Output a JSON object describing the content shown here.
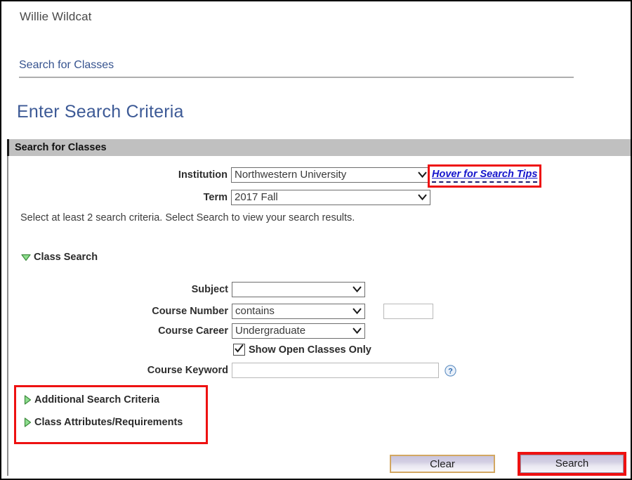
{
  "header": {
    "user_name": "Willie Wildcat",
    "breadcrumb_link": "Search for Classes",
    "page_title": "Enter Search Criteria"
  },
  "group": {
    "header_label": "Search for Classes"
  },
  "form": {
    "institution": {
      "label": "Institution",
      "value": "Northwestern University"
    },
    "term": {
      "label": "Term",
      "value": "2017 Fall"
    },
    "search_tips_link": "Hover for Search Tips",
    "instructions": "Select at least 2 search criteria. Select Search to view your search results.",
    "class_search_section": {
      "label": "Class Search",
      "expanded": true,
      "toggle_icon": "triangle-down-icon"
    },
    "subject": {
      "label": "Subject",
      "value": ""
    },
    "course_number": {
      "label": "Course Number",
      "operator": "contains",
      "value": ""
    },
    "course_career": {
      "label": "Course Career",
      "value": "Undergraduate"
    },
    "show_open_only": {
      "label": "Show Open Classes Only",
      "checked": true
    },
    "course_keyword": {
      "label": "Course Keyword",
      "value": "",
      "help_icon": "question-mark-help-icon"
    },
    "additional_search_criteria": {
      "label": "Additional Search Criteria",
      "expanded": false,
      "toggle_icon": "triangle-right-icon"
    },
    "class_attributes": {
      "label": "Class Attributes/Requirements",
      "expanded": false,
      "toggle_icon": "triangle-right-icon"
    }
  },
  "actions": {
    "clear_label": "Clear",
    "search_label": "Search"
  },
  "colors": {
    "highlight_red": "#ee1111",
    "group_header_gray": "#c0c0c0",
    "title_blue": "#3d5a96",
    "link_blue": "#36538f",
    "tips_link_blue": "#1515cc",
    "triangle_green": "#7fd47f",
    "clear_button_border": "#d2a762"
  }
}
